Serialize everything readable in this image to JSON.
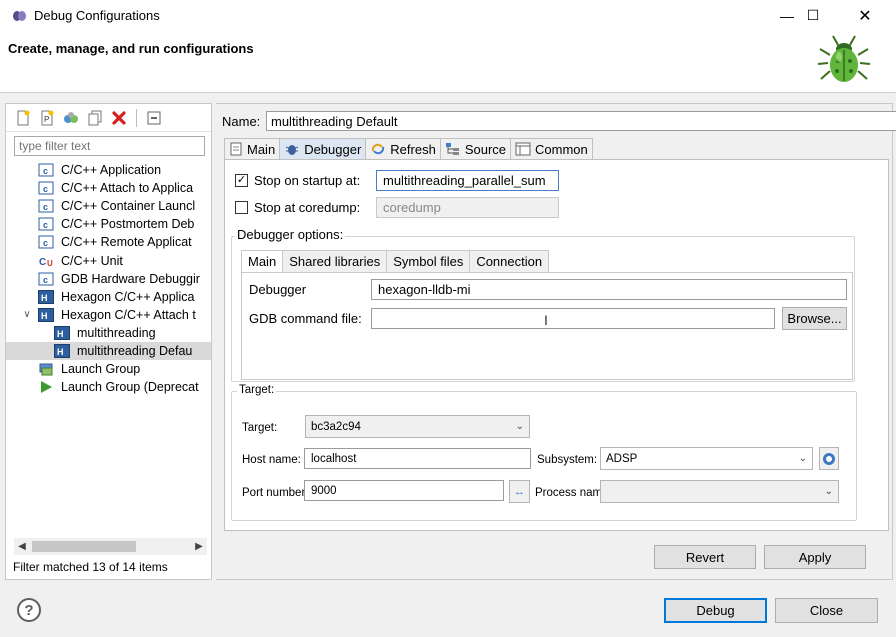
{
  "window": {
    "title": "Debug Configurations",
    "minimize": "—",
    "maximize": "☐",
    "close": "✕"
  },
  "header": {
    "heading": "Create, manage, and run configurations"
  },
  "toolbar": {
    "icons": [
      "new-config-icon",
      "new-prototype-icon",
      "export-icon",
      "duplicate-icon",
      "delete-icon",
      "collapse-all-icon"
    ]
  },
  "filter": {
    "placeholder": "type filter text"
  },
  "tree": {
    "items": [
      {
        "label": "C/C++ Application",
        "icon": "c-badge",
        "level": 1
      },
      {
        "label": "C/C++ Attach to Applica",
        "icon": "c-badge",
        "level": 1
      },
      {
        "label": "C/C++ Container Launcl",
        "icon": "c-badge",
        "level": 1
      },
      {
        "label": "C/C++ Postmortem Deb",
        "icon": "c-badge",
        "level": 1
      },
      {
        "label": "C/C++ Remote Applicat",
        "icon": "c-badge",
        "level": 1
      },
      {
        "label": "C/C++ Unit",
        "icon": "cu-badge",
        "level": 1
      },
      {
        "label": "GDB Hardware Debuggir",
        "icon": "c-badge",
        "level": 1
      },
      {
        "label": "Hexagon C/C++ Applica",
        "icon": "h-badge",
        "level": 1
      },
      {
        "label": "Hexagon C/C++ Attach t",
        "icon": "h-badge",
        "level": 1,
        "expanded": true
      },
      {
        "label": "multithreading",
        "icon": "h-badge",
        "level": 2
      },
      {
        "label": "multithreading Defau",
        "icon": "h-badge",
        "level": 2,
        "selected": true
      },
      {
        "label": "Launch Group",
        "icon": "launch-group",
        "level": 1
      },
      {
        "label": "Launch Group (Deprecat",
        "icon": "launch-arrow",
        "level": 1
      }
    ]
  },
  "status": {
    "filter_matched": "Filter matched 13 of 14 items"
  },
  "config": {
    "name_label": "Name:",
    "name_value": "multithreading Default"
  },
  "tabs": [
    {
      "label": "Main",
      "icon": "main-tab-icon"
    },
    {
      "label": "Debugger",
      "icon": "bug-tab-icon",
      "active": true
    },
    {
      "label": "Refresh",
      "icon": "refresh-tab-icon"
    },
    {
      "label": "Source",
      "icon": "source-tab-icon"
    },
    {
      "label": "Common",
      "icon": "common-tab-icon"
    }
  ],
  "debugger": {
    "stop_startup_label": "Stop on startup at:",
    "stop_startup_checked": true,
    "stop_startup_value": "multithreading_parallel_sum",
    "stop_coredump_label": "Stop at coredump:",
    "stop_coredump_checked": false,
    "coredump_value": "coredump",
    "options_title": "Debugger options:",
    "inner_tabs": [
      "Main",
      "Shared libraries",
      "Symbol files",
      "Connection"
    ],
    "debugger_label": "Debugger",
    "debugger_value": "hexagon-lldb-mi",
    "gdb_cmd_label": "GDB command file:",
    "gdb_cmd_value": "",
    "browse_label": "Browse..."
  },
  "target": {
    "group_title": "Target:",
    "target_label": "Target:",
    "target_value": "bc3a2c94",
    "host_label": "Host name:",
    "host_value": "localhost",
    "subsystem_label": "Subsystem:",
    "subsystem_value": "ADSP",
    "port_label": "Port number:",
    "port_value": "9000",
    "process_label": "Process name:",
    "process_value": ""
  },
  "buttons": {
    "revert": "Revert",
    "apply": "Apply",
    "debug": "Debug",
    "close": "Close",
    "help": "?"
  }
}
